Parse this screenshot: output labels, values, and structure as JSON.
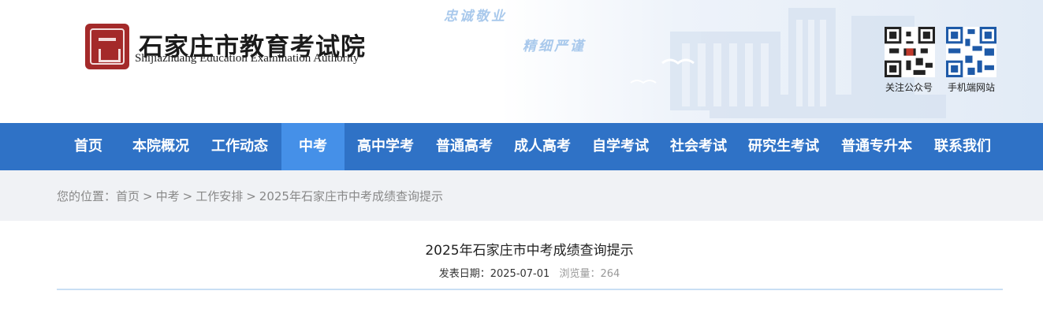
{
  "header": {
    "logo_cn": "石家庄市教育考试院",
    "logo_en": "Shijiazhuang Education Examination Authority",
    "slogan_1": "忠诚敬业",
    "slogan_2": "精细严谨",
    "qr_wechat_label": "关注公众号",
    "qr_mobile_label": "手机端网站"
  },
  "nav": {
    "items": [
      {
        "label": "首页"
      },
      {
        "label": "本院概况"
      },
      {
        "label": "工作动态"
      },
      {
        "label": "中考"
      },
      {
        "label": "高中学考"
      },
      {
        "label": "普通高考"
      },
      {
        "label": "成人高考"
      },
      {
        "label": "自学考试"
      },
      {
        "label": "社会考试"
      },
      {
        "label": "研究生考试"
      },
      {
        "label": "普通专升本"
      },
      {
        "label": "联系我们"
      }
    ],
    "active": "中考",
    "color": "#2f72c6",
    "active_color": "#4590e8"
  },
  "breadcrumb": {
    "prefix": "您的位置：",
    "items": [
      "首页",
      "中考",
      "工作安排",
      "2025年石家庄市中考成绩查询提示"
    ],
    "separator": ">"
  },
  "article": {
    "title": "2025年石家庄市中考成绩查询提示",
    "date_label": "发表日期：",
    "date": "2025-07-01",
    "views_label": "浏览量：",
    "views": "264"
  }
}
